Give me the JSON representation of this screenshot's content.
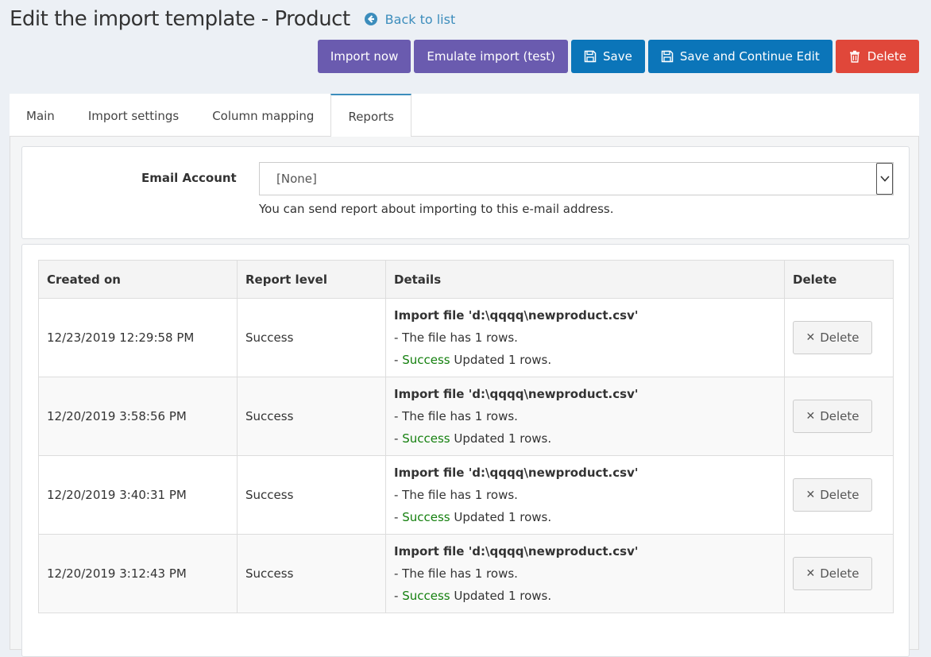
{
  "header": {
    "title": "Edit the import template - Product",
    "back_label": "Back to list"
  },
  "toolbar": {
    "import_now": "Import now",
    "emulate": "Emulate import (test)",
    "save": "Save",
    "save_continue": "Save and Continue Edit",
    "delete": "Delete"
  },
  "tabs": [
    {
      "label": "Main"
    },
    {
      "label": "Import settings"
    },
    {
      "label": "Column mapping"
    },
    {
      "label": "Reports"
    }
  ],
  "email": {
    "label": "Email Account",
    "selected": "[None]",
    "hint": "You can send report about importing to this e-mail address."
  },
  "reports": {
    "columns": [
      "Created on",
      "Report level",
      "Details",
      "Delete"
    ],
    "delete_label": "Delete",
    "rows": [
      {
        "created": "12/23/2019 12:29:58 PM",
        "level": "Success",
        "file": "Import file 'd:\\qqqq\\newproduct.csv'",
        "rows_line": "- The file has 1 rows.",
        "prefix": "- ",
        "status": "Success",
        "updated": " Updated 1 rows."
      },
      {
        "created": "12/20/2019 3:58:56 PM",
        "level": "Success",
        "file": "Import file 'd:\\qqqq\\newproduct.csv'",
        "rows_line": "- The file has 1 rows.",
        "prefix": "- ",
        "status": "Success",
        "updated": " Updated 1 rows."
      },
      {
        "created": "12/20/2019 3:40:31 PM",
        "level": "Success",
        "file": "Import file 'd:\\qqqq\\newproduct.csv'",
        "rows_line": "- The file has 1 rows.",
        "prefix": "- ",
        "status": "Success",
        "updated": " Updated 1 rows."
      },
      {
        "created": "12/20/2019 3:12:43 PM",
        "level": "Success",
        "file": "Import file 'd:\\qqqq\\newproduct.csv'",
        "rows_line": "- The file has 1 rows.",
        "prefix": "- ",
        "status": "Success",
        "updated": " Updated 1 rows."
      }
    ]
  },
  "colors": {
    "purple": "#6a5baf",
    "blue": "#0b75b9",
    "red": "#e0473a",
    "link": "#3c8dbc",
    "success": "#15800f"
  }
}
